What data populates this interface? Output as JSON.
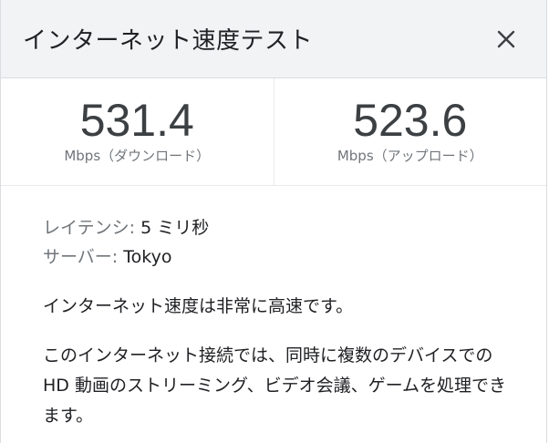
{
  "header": {
    "title": "インターネット速度テスト",
    "close_icon": "close-icon"
  },
  "results": {
    "download": {
      "value": "531.4",
      "label": "Mbps（ダウンロード）"
    },
    "upload": {
      "value": "523.6",
      "label": "Mbps（アップロード）"
    }
  },
  "details": {
    "latency_label": "レイテンシ:",
    "latency_value": " 5 ミリ秒",
    "server_label": "サーバー:",
    "server_value": " Tokyo",
    "summary": "インターネット速度は非常に高速です。",
    "description": "このインターネット接続では、同時に複数のデバイスでの HD 動画のストリーミング、ビデオ会議、ゲームを処理できます。"
  },
  "colors": {
    "header_bg": "#f1f3f4",
    "text_primary": "#202124",
    "text_secondary": "#70757a",
    "divider": "#dadce0"
  }
}
